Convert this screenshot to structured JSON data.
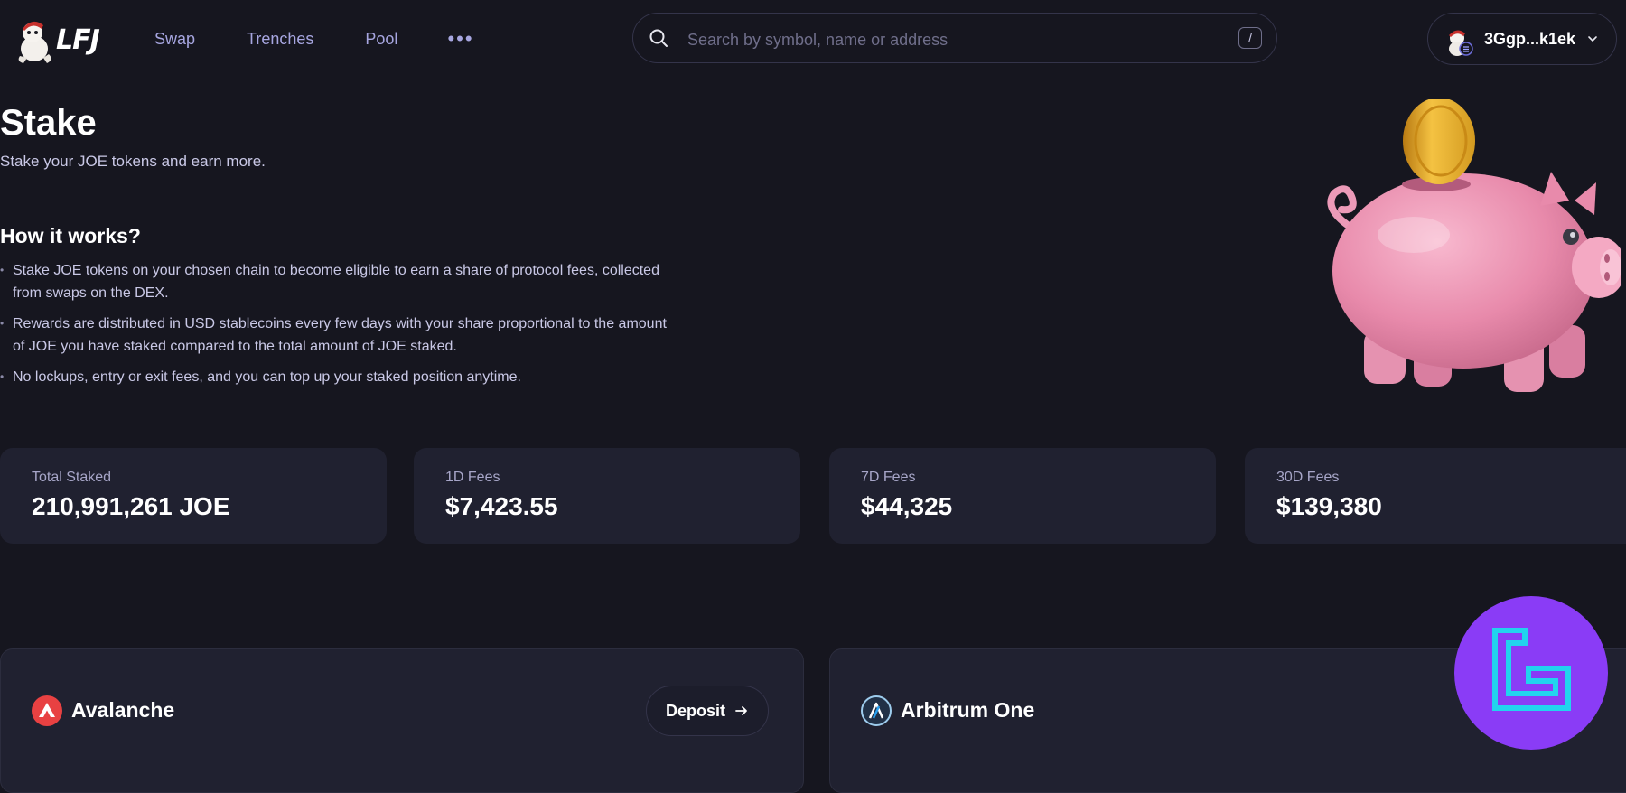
{
  "header": {
    "logo_text": "LFJ",
    "nav": [
      {
        "label": "Swap"
      },
      {
        "label": "Trenches"
      },
      {
        "label": "Pool"
      }
    ],
    "more_label": "•••",
    "search": {
      "placeholder": "Search by symbol, name or address",
      "shortcut": "/"
    },
    "wallet": {
      "address": "3Ggp...k1ek"
    }
  },
  "hero": {
    "title": "Stake",
    "subtitle": "Stake your JOE tokens and earn more.",
    "how_title": "How it works?",
    "how_items": [
      "Stake JOE tokens on your chosen chain to become eligible to earn a share of protocol fees, collected from swaps on the DEX.",
      "Rewards are distributed in USD stablecoins every few days with your share proportional to the amount of JOE you have staked compared to the total amount of JOE staked.",
      "No lockups, entry or exit fees, and you can top up your staked position anytime."
    ]
  },
  "stats": [
    {
      "label": "Total Staked",
      "value": "210,991,261 JOE"
    },
    {
      "label": "1D Fees",
      "value": "$7,423.55"
    },
    {
      "label": "7D Fees",
      "value": "$44,325"
    },
    {
      "label": "30D Fees",
      "value": "$139,380"
    }
  ],
  "chains": [
    {
      "name": "Avalanche",
      "icon": "avalanche-icon",
      "deposit_label": "Deposit"
    },
    {
      "name": "Arbitrum One",
      "icon": "arbitrum-icon"
    }
  ],
  "colors": {
    "background": "#16161f",
    "card": "#202130",
    "nav_text": "#a7a6e0",
    "avalanche_red": "#e84142",
    "arbitrum_blue": "#28a0f0",
    "watermark_purple": "#8a3cf6",
    "watermark_cyan": "#22d3ee"
  }
}
